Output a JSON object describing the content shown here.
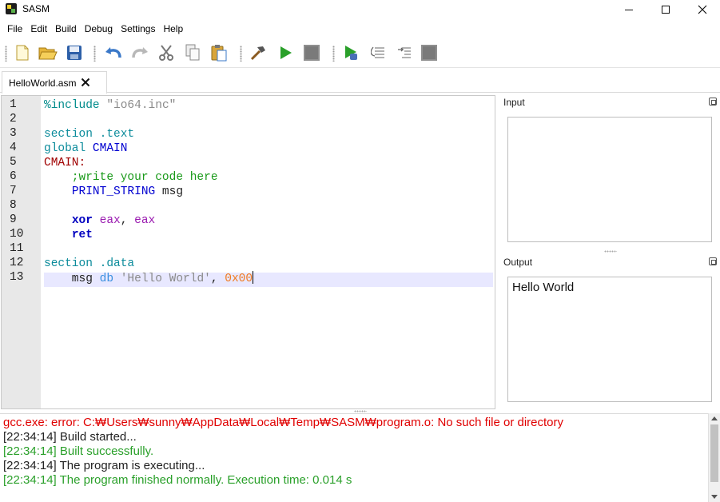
{
  "window": {
    "title": "SASM"
  },
  "menu": [
    "File",
    "Edit",
    "Build",
    "Debug",
    "Settings",
    "Help"
  ],
  "toolbar": {
    "icons": [
      "new-file-icon",
      "open-folder-icon",
      "save-icon",
      "undo-icon",
      "redo-icon",
      "cut-icon",
      "copy-icon",
      "paste-icon",
      "build-hammer-icon",
      "run-play-icon",
      "stop-icon",
      "debug-icon",
      "step-over-icon",
      "step-into-icon",
      "debug-stop-icon"
    ]
  },
  "tab": {
    "label": "HelloWorld.asm"
  },
  "editor": {
    "line_numbers": [
      "1",
      "2",
      "3",
      "4",
      "5",
      "6",
      "7",
      "8",
      "9",
      "10",
      "11",
      "12",
      "13"
    ],
    "lines": [
      [
        [
          "%include ",
          "c-pre"
        ],
        [
          "\"io64.inc\"",
          "c-str"
        ]
      ],
      [],
      [
        [
          "section .text",
          "c-kw"
        ]
      ],
      [
        [
          "global ",
          "c-kw"
        ],
        [
          "CMAIN",
          "c-blue"
        ]
      ],
      [
        [
          "CMAIN:",
          "c-red"
        ]
      ],
      [
        [
          "    ;write your code here",
          "c-cmt"
        ]
      ],
      [
        [
          "    ",
          "c-plain"
        ],
        [
          "PRINT_STRING",
          "c-blue"
        ],
        [
          " msg",
          "c-plain"
        ]
      ],
      [],
      [
        [
          "    ",
          "c-plain"
        ],
        [
          "xor",
          "c-bold"
        ],
        [
          " ",
          "c-plain"
        ],
        [
          "eax",
          "c-reg"
        ],
        [
          ", ",
          "c-plain"
        ],
        [
          "eax",
          "c-reg"
        ]
      ],
      [
        [
          "    ",
          "c-plain"
        ],
        [
          "ret",
          "c-bold"
        ]
      ],
      [],
      [
        [
          "section .data",
          "c-kw"
        ]
      ],
      [
        [
          "    msg ",
          "c-plain"
        ],
        [
          "db",
          "c-db"
        ],
        [
          " ",
          "c-plain"
        ],
        [
          "'Hello World'",
          "c-str"
        ],
        [
          ", ",
          "c-plain"
        ],
        [
          "0x00",
          "c-num"
        ]
      ]
    ]
  },
  "input_panel": {
    "label": "Input",
    "value": ""
  },
  "output_panel": {
    "label": "Output",
    "value": "Hello World"
  },
  "log": [
    {
      "text": "gcc.exe: error: C:₩Users₩sunny₩AppData₩Local₩Temp₩SASM₩program.o: No such file or directory",
      "cls": "log-red"
    },
    {
      "text": "[22:34:14] Build started...",
      "cls": "log-black"
    },
    {
      "text": "[22:34:14] Built successfully.",
      "cls": "log-green"
    },
    {
      "text": "[22:34:14] The program is executing...",
      "cls": "log-black"
    },
    {
      "text": "[22:34:14] The program finished normally. Execution time: 0.014 s",
      "cls": "log-green"
    }
  ]
}
